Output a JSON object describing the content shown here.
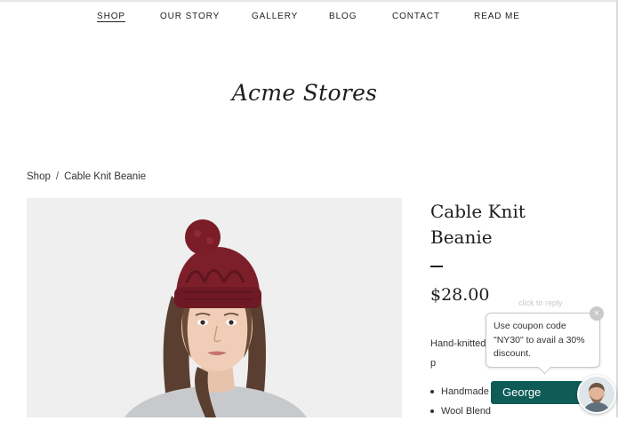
{
  "nav": {
    "items": [
      {
        "label": "SHOP",
        "active": true
      },
      {
        "label": "OUR STORY",
        "active": false
      },
      {
        "label": "GALLERY",
        "active": false
      },
      {
        "label": "BLOG",
        "active": false
      },
      {
        "label": "CONTACT",
        "active": false
      },
      {
        "label": "READ ME",
        "active": false
      }
    ]
  },
  "site": {
    "brand": "Acme Stores"
  },
  "breadcrumb": {
    "root": "Shop",
    "separator": "/",
    "current": "Cable Knit Beanie"
  },
  "product": {
    "title": "Cable Knit Beanie",
    "price": "$28.00",
    "description": "Hand-knitted beanie, handmade p",
    "features": [
      "Handmade",
      "Wool Blend"
    ],
    "image": "woman-wearing-burgundy-knit-beanie"
  },
  "chat": {
    "hint": "click to reply",
    "message": "Use coupon code \"NY30\" to avail a 30% discount.",
    "agent_name": "George",
    "close_icon": "close-icon",
    "bar_color": "#0f5c57"
  }
}
